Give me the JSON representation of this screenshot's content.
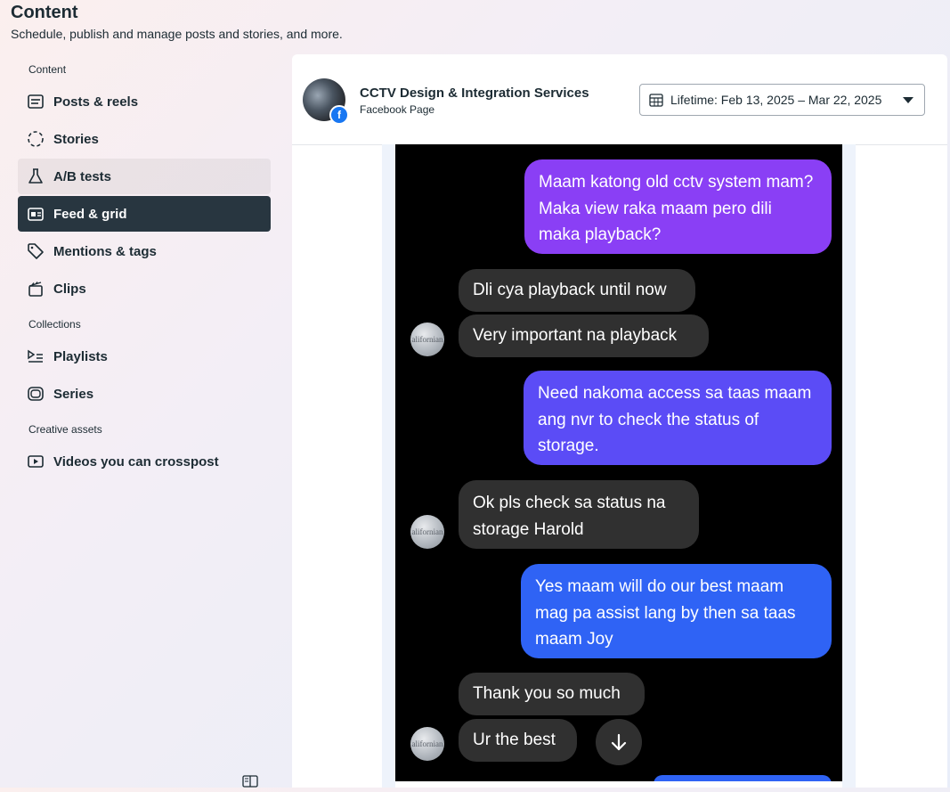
{
  "header": {
    "title": "Content",
    "subtitle": "Schedule, publish and manage posts and stories, and more."
  },
  "sidebar": {
    "sections": {
      "content": "Content",
      "collections": "Collections",
      "creative": "Creative assets"
    },
    "items": [
      {
        "label": "Posts & reels",
        "icon": "posts-icon"
      },
      {
        "label": "Stories",
        "icon": "stories-icon"
      },
      {
        "label": "A/B tests",
        "icon": "flask-icon"
      },
      {
        "label": "Feed & grid",
        "icon": "feed-grid-icon",
        "active": true
      },
      {
        "label": "Mentions & tags",
        "icon": "tag-icon"
      },
      {
        "label": "Clips",
        "icon": "clapper-icon"
      },
      {
        "label": "Playlists",
        "icon": "playlist-icon"
      },
      {
        "label": "Series",
        "icon": "series-icon"
      },
      {
        "label": "Videos you can crosspost",
        "icon": "video-icon"
      }
    ]
  },
  "page": {
    "name": "CCTV Design & Integration Services",
    "type": "Facebook Page"
  },
  "date_range": {
    "label": "Lifetime: Feb 13, 2025 – Mar 22, 2025"
  },
  "chat": {
    "avatar_text": "alifornian",
    "messages": [
      {
        "from": "me",
        "text": "Maam katong old cctv system mam? Maka view raka maam pero dili maka playback?"
      },
      {
        "from": "them",
        "text": "Dli cya playback until now"
      },
      {
        "from": "them",
        "text": "Very important na playback"
      },
      {
        "from": "me",
        "text": "Need nakoma access sa taas maam ang nvr to check the status of storage."
      },
      {
        "from": "them",
        "text": "Ok pls check sa status na storage Harold"
      },
      {
        "from": "me",
        "text": "Yes maam will do our best maam mag pa assist lang by then sa taas maam Joy"
      },
      {
        "from": "them",
        "text": "Thank you so much"
      },
      {
        "from": "them",
        "text": "Ur the best"
      }
    ]
  },
  "colors": {
    "active_nav": "#283640",
    "sent_top": "#8a3ff5",
    "sent_mid": "#5b4cf6",
    "sent_bottom": "#2f63f5",
    "received": "#303030",
    "facebook": "#1877f2"
  }
}
